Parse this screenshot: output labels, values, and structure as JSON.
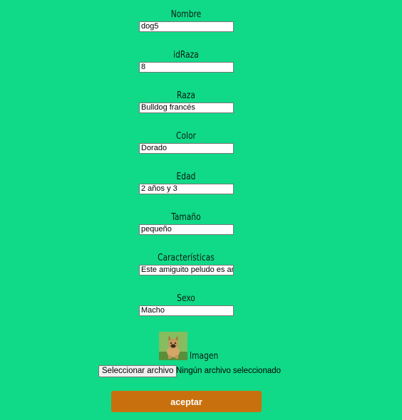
{
  "form": {
    "fields": [
      {
        "label": "Nombre",
        "value": "dog5"
      },
      {
        "label": "idRaza",
        "value": "8"
      },
      {
        "label": "Raza",
        "value": "Bulldog francés"
      },
      {
        "label": "Color",
        "value": "Dorado"
      },
      {
        "label": "Edad",
        "value": "2 años y 3"
      },
      {
        "label": "Tamaño",
        "value": "pequeño"
      },
      {
        "label": "Características",
        "value": "Este amiguito peludo es am"
      },
      {
        "label": "Sexo",
        "value": "Macho"
      }
    ],
    "image_label": "Imagen",
    "file_button_label": "Seleccionar archivo",
    "file_status": "Ningún archivo seleccionado",
    "submit_label": "aceptar"
  },
  "colors": {
    "background": "#10da88",
    "submit": "#c8700e"
  }
}
